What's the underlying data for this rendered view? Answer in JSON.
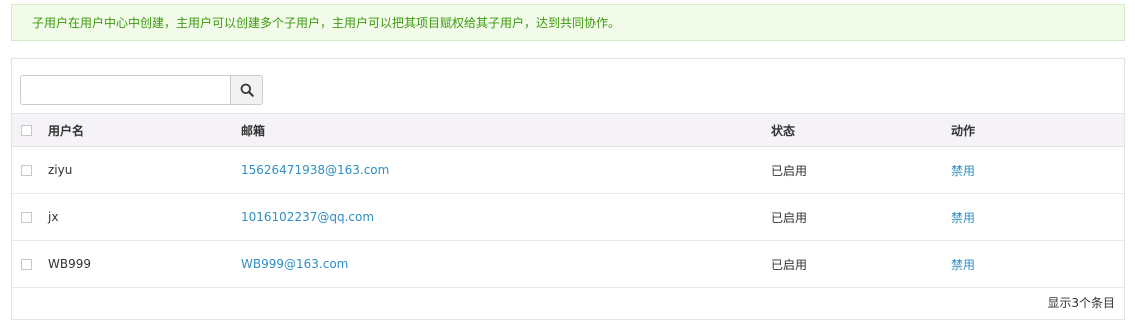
{
  "notice": {
    "text": "子用户在用户中心中创建，主用户可以创建多个子用户，主用户可以把其项目赋权给其子用户，达到共同协作。"
  },
  "search": {
    "value": "",
    "placeholder": "",
    "icon": "search-icon"
  },
  "table": {
    "headers": {
      "name": "用户名",
      "email": "邮箱",
      "status": "状态",
      "action": "动作"
    },
    "rows": [
      {
        "name": "ziyu",
        "email": "15626471938@163.com",
        "status": "已启用",
        "action": "禁用"
      },
      {
        "name": "jx",
        "email": "1016102237@qq.com",
        "status": "已启用",
        "action": "禁用"
      },
      {
        "name": "WB999",
        "email": "WB999@163.com",
        "status": "已启用",
        "action": "禁用"
      }
    ]
  },
  "footer": {
    "count_text": "显示3个条目"
  },
  "colors": {
    "notice_bg": "#f2fbe9",
    "notice_text": "#3c9a0f",
    "link": "#2f8ec4",
    "header_bg": "#f6f3f8"
  }
}
